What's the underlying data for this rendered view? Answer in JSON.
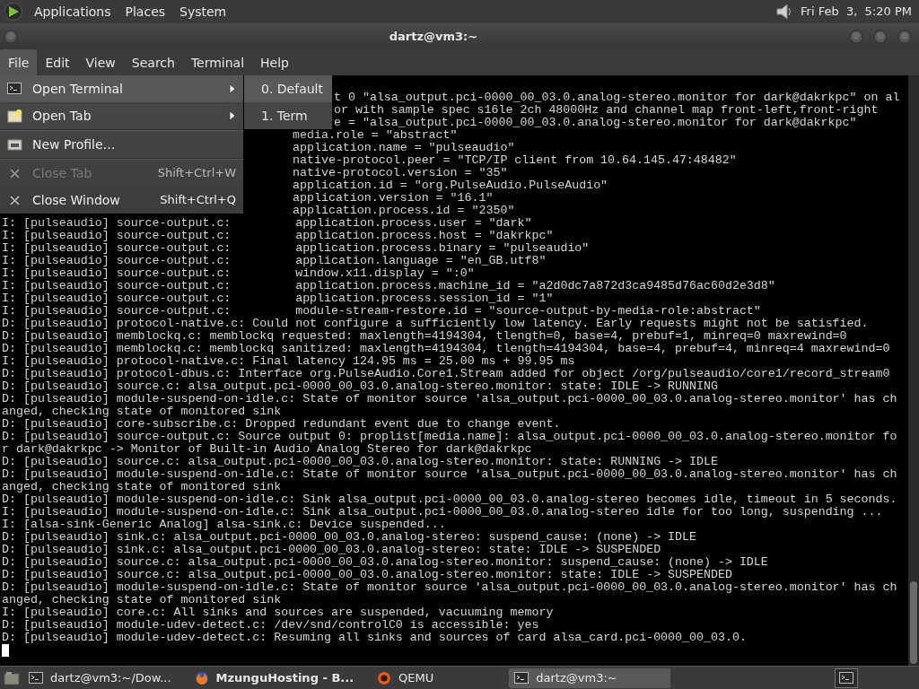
{
  "top_panel": {
    "menus": [
      "Applications",
      "Places",
      "System"
    ],
    "clock": "Fri Feb  3,  5:20 PM"
  },
  "window": {
    "title": "dartz@vm3:~"
  },
  "menubar": [
    {
      "label": "File",
      "selected": true
    },
    {
      "label": "Edit",
      "selected": false
    },
    {
      "label": "View",
      "selected": false
    },
    {
      "label": "Search",
      "selected": false
    },
    {
      "label": "Terminal",
      "selected": false
    },
    {
      "label": "Help",
      "selected": false
    }
  ],
  "file_menu": [
    {
      "kind": "item",
      "label": "Open Terminal",
      "selected": true,
      "disabled": false,
      "submenu": true
    },
    {
      "kind": "item",
      "label": "Open Tab",
      "selected": false,
      "disabled": false,
      "submenu": true
    },
    {
      "kind": "separator"
    },
    {
      "kind": "item",
      "label": "New Profile…",
      "selected": false,
      "disabled": false,
      "submenu": false
    },
    {
      "kind": "separator"
    },
    {
      "kind": "item",
      "label": "Close Tab",
      "shortcut": "Shift+Ctrl+W",
      "selected": false,
      "disabled": true,
      "submenu": false
    },
    {
      "kind": "item",
      "label": "Close Window",
      "shortcut": "Shift+Ctrl+Q",
      "selected": false,
      "disabled": false,
      "submenu": false
    }
  ],
  "submenu": [
    {
      "label": "0. Default",
      "selected": true
    },
    {
      "label": "1. Term",
      "selected": false
    }
  ],
  "terminal": {
    "lines": [
      {
        "kind": "behind_submenu",
        "text": "t 0 \"alsa_output.pci-0000_00_03.0.analog-stereo.monitor for dark@dakrkpc\" on al"
      },
      {
        "kind": "behind_submenu",
        "text": "or with sample spec s16le 2ch 48000Hz and channel map front-left,front-right"
      },
      {
        "kind": "behind_submenu",
        "text": "e = \"alsa_output.pci-0000_00_03.0.analog-stereo.monitor for dark@dakrkpc\""
      },
      {
        "kind": "behind_menu",
        "text": "media.role = \"abstract\""
      },
      {
        "kind": "behind_menu",
        "text": "application.name = \"pulseaudio\""
      },
      {
        "kind": "behind_menu",
        "text": "native-protocol.peer = \"TCP/IP client from 10.64.145.47:48482\""
      },
      {
        "kind": "behind_menu",
        "text": "native-protocol.version = \"35\""
      },
      {
        "kind": "behind_menu",
        "text": "application.id = \"org.PulseAudio.PulseAudio\""
      },
      {
        "kind": "behind_menu",
        "text": "application.version = \"16.1\""
      },
      {
        "kind": "behind_menu",
        "text": "application.process.id = \"2350\""
      },
      {
        "kind": "full",
        "text": "I: [pulseaudio] source-output.c:         application.process.user = \"dark\""
      },
      {
        "kind": "full",
        "text": "I: [pulseaudio] source-output.c:         application.process.host = \"dakrkpc\""
      },
      {
        "kind": "full",
        "text": "I: [pulseaudio] source-output.c:         application.process.binary = \"pulseaudio\""
      },
      {
        "kind": "full",
        "text": "I: [pulseaudio] source-output.c:         application.language = \"en_GB.utf8\""
      },
      {
        "kind": "full",
        "text": "I: [pulseaudio] source-output.c:         window.x11.display = \":0\""
      },
      {
        "kind": "full",
        "text": "I: [pulseaudio] source-output.c:         application.process.machine_id = \"a2d0dc7a872d3ca9485d76ac60d2e3d8\""
      },
      {
        "kind": "full",
        "text": "I: [pulseaudio] source-output.c:         application.process.session_id = \"1\""
      },
      {
        "kind": "full",
        "text": "I: [pulseaudio] source-output.c:         module-stream-restore.id = \"source-output-by-media-role:abstract\""
      },
      {
        "kind": "full",
        "text": "D: [pulseaudio] protocol-native.c: Could not configure a sufficiently low latency. Early requests might not be satisfied."
      },
      {
        "kind": "full",
        "text": "D: [pulseaudio] memblockq.c: memblockq requested: maxlength=4194304, tlength=0, base=4, prebuf=1, minreq=0 maxrewind=0"
      },
      {
        "kind": "full",
        "text": "D: [pulseaudio] memblockq.c: memblockq sanitized: maxlength=4194304, tlength=4194304, base=4, prebuf=4, minreq=4 maxrewind=0"
      },
      {
        "kind": "full",
        "text": "I: [pulseaudio] protocol-native.c: Final latency 124.95 ms = 25.00 ms + 99.95 ms"
      },
      {
        "kind": "full",
        "text": "D: [pulseaudio] protocol-dbus.c: Interface org.PulseAudio.Core1.Stream added for object /org/pulseaudio/core1/record_stream0"
      },
      {
        "kind": "full",
        "text": "D: [pulseaudio] source.c: alsa_output.pci-0000_00_03.0.analog-stereo.monitor: state: IDLE -> RUNNING"
      },
      {
        "kind": "full",
        "text": "D: [pulseaudio] module-suspend-on-idle.c: State of monitor source 'alsa_output.pci-0000_00_03.0.analog-stereo.monitor' has ch"
      },
      {
        "kind": "full",
        "text": "anged, checking state of monitored sink"
      },
      {
        "kind": "full",
        "text": "D: [pulseaudio] core-subscribe.c: Dropped redundant event due to change event."
      },
      {
        "kind": "full",
        "text": "D: [pulseaudio] source-output.c: Source output 0: proplist[media.name]: alsa_output.pci-0000_00_03.0.analog-stereo.monitor fo"
      },
      {
        "kind": "full",
        "text": "r dark@dakrkpc -> Monitor of Built-in Audio Analog Stereo for dark@dakrkpc"
      },
      {
        "kind": "full",
        "text": "D: [pulseaudio] source.c: alsa_output.pci-0000_00_03.0.analog-stereo.monitor: state: RUNNING -> IDLE"
      },
      {
        "kind": "full",
        "text": "D: [pulseaudio] module-suspend-on-idle.c: State of monitor source 'alsa_output.pci-0000_00_03.0.analog-stereo.monitor' has ch"
      },
      {
        "kind": "full",
        "text": "anged, checking state of monitored sink"
      },
      {
        "kind": "full",
        "text": "D: [pulseaudio] module-suspend-on-idle.c: Sink alsa_output.pci-0000_00_03.0.analog-stereo becomes idle, timeout in 5 seconds."
      },
      {
        "kind": "full",
        "text": "I: [pulseaudio] module-suspend-on-idle.c: Sink alsa_output.pci-0000_00_03.0.analog-stereo idle for too long, suspending ..."
      },
      {
        "kind": "full",
        "text": "I: [alsa-sink-Generic Analog] alsa-sink.c: Device suspended..."
      },
      {
        "kind": "full",
        "text": "D: [pulseaudio] sink.c: alsa_output.pci-0000_00_03.0.analog-stereo: suspend_cause: (none) -> IDLE"
      },
      {
        "kind": "full",
        "text": "D: [pulseaudio] sink.c: alsa_output.pci-0000_00_03.0.analog-stereo: state: IDLE -> SUSPENDED"
      },
      {
        "kind": "full",
        "text": "D: [pulseaudio] source.c: alsa_output.pci-0000_00_03.0.analog-stereo.monitor: suspend_cause: (none) -> IDLE"
      },
      {
        "kind": "full",
        "text": "D: [pulseaudio] source.c: alsa_output.pci-0000_00_03.0.analog-stereo.monitor: state: IDLE -> SUSPENDED"
      },
      {
        "kind": "full",
        "text": "D: [pulseaudio] module-suspend-on-idle.c: State of monitor source 'alsa_output.pci-0000_00_03.0.analog-stereo.monitor' has ch"
      },
      {
        "kind": "full",
        "text": "anged, checking state of monitored sink"
      },
      {
        "kind": "full",
        "text": "I: [pulseaudio] core.c: All sinks and sources are suspended, vacuuming memory"
      },
      {
        "kind": "full",
        "text": "D: [pulseaudio] module-udev-detect.c: /dev/snd/controlC0 is accessible: yes"
      },
      {
        "kind": "full",
        "text": "D: [pulseaudio] module-udev-detect.c: Resuming all sinks and sources of card alsa_card.pci-0000_00_03.0."
      }
    ]
  },
  "taskbar": [
    {
      "kind": "terminal",
      "label": "dartz@vm3:~/Dow...",
      "selected": false,
      "attention": false
    },
    {
      "kind": "browser",
      "label": "MzunguHosting - B...",
      "selected": false,
      "attention": true
    },
    {
      "kind": "emulator",
      "label": "QEMU",
      "selected": false,
      "attention": false
    },
    {
      "kind": "terminal",
      "label": "dartz@vm3:~",
      "selected": true,
      "attention": false
    }
  ]
}
